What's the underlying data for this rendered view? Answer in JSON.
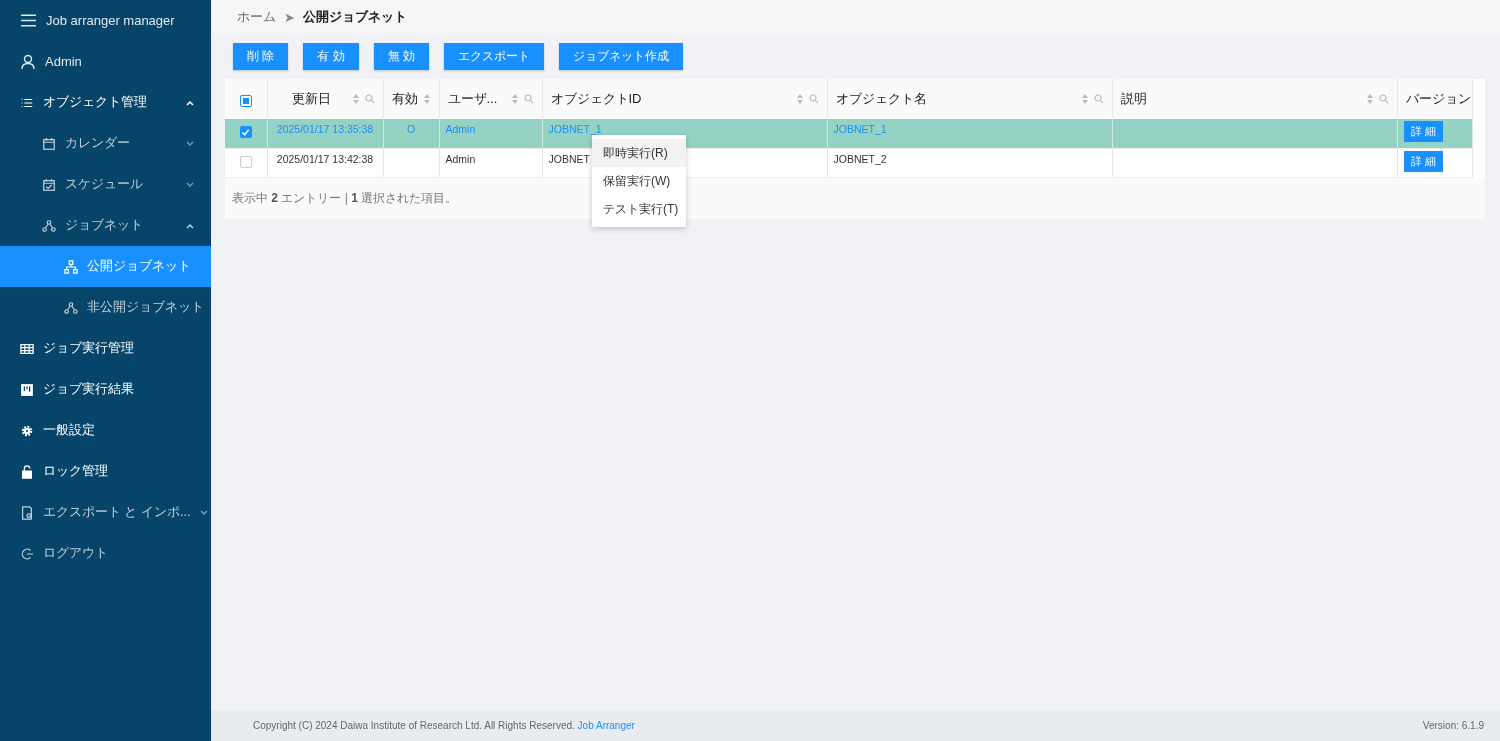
{
  "sidebar": {
    "title": "Job arranger manager",
    "user": "Admin",
    "items": [
      {
        "label": "オブジェクト管理",
        "expanded": true,
        "children": [
          {
            "label": "カレンダー",
            "expanded": false
          },
          {
            "label": "スケジュール",
            "expanded": false
          },
          {
            "label": "ジョブネット",
            "expanded": true,
            "children": [
              {
                "label": "公開ジョブネット",
                "selected": true
              },
              {
                "label": "非公開ジョブネット",
                "selected": false
              }
            ]
          }
        ]
      },
      {
        "label": "ジョブ実行管理"
      },
      {
        "label": "ジョブ実行結果"
      },
      {
        "label": "一般設定"
      },
      {
        "label": "ロック管理"
      },
      {
        "label": "エクスポート と インポ...",
        "expanded": false
      },
      {
        "label": "ログアウト"
      }
    ]
  },
  "breadcrumb": [
    "ホーム",
    "➤",
    "公開ジョブネット"
  ],
  "toolbar": [
    "削 除",
    "有 効",
    "無 効",
    "エクスポート",
    "ジョブネット作成"
  ],
  "table": {
    "columns": [
      {
        "label": "更新日",
        "sortable": true,
        "searchable": true
      },
      {
        "label": "有効",
        "sortable": true,
        "searchable": false
      },
      {
        "label": "ユーザ...",
        "sortable": true,
        "searchable": true
      },
      {
        "label": "オブジェクトID",
        "sortable": true,
        "searchable": true
      },
      {
        "label": "オブジェクト名",
        "sortable": true,
        "searchable": true
      },
      {
        "label": "説明",
        "sortable": true,
        "searchable": true
      },
      {
        "label": "バージョン",
        "sortable": false,
        "searchable": false
      }
    ],
    "rows": [
      {
        "selected": true,
        "cells": [
          "2025/01/17 13:35:38",
          "O",
          "Admin",
          "JOBNET_1",
          "JOBNET_1",
          ""
        ],
        "button": "詳 細"
      },
      {
        "selected": false,
        "cells": [
          "2025/01/17 13:42:38",
          "",
          "Admin",
          "JOBNET",
          "JOBNET_2",
          ""
        ],
        "button": "詳 細"
      }
    ],
    "select_all_partial": true,
    "summary": "表示中 **2** エントリー  |  **1** 選択された項目。"
  },
  "context_menu": [
    {
      "label": "即時実行(R)",
      "selected": true
    },
    {
      "label": "保留実行(W)",
      "selected": false
    },
    {
      "label": "テスト実行(T)",
      "selected": false
    }
  ],
  "footer": {
    "copyright": "Copyright (C) 2024 Daiwa Institute of Research Ltd. All Rights Reserved.",
    "link": "Job Arranger",
    "version": "Version: 6.1.9"
  }
}
